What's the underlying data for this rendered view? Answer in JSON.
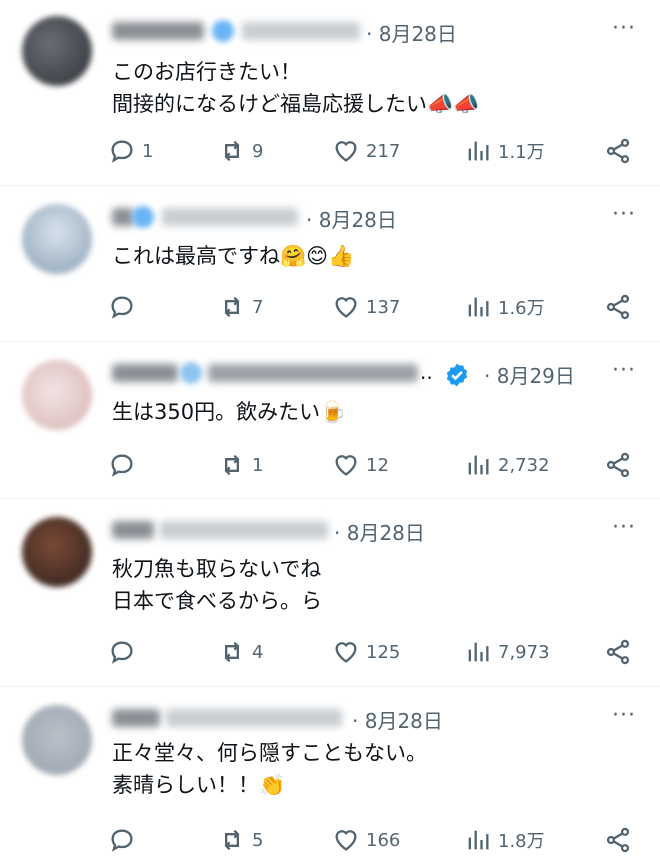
{
  "tweets": [
    {
      "date": "8月28日",
      "more": "···",
      "lines": [
        "このお店行きたい！",
        "間接的になるけど福島応援したい📣📣"
      ],
      "replies": "1",
      "retweets": "9",
      "likes": "217",
      "views": "1.1万"
    },
    {
      "date": "8月28日",
      "more": "···",
      "lines": [
        "これは最高ですね🤗😊👍"
      ],
      "replies": "",
      "retweets": "7",
      "likes": "137",
      "views": "1.6万"
    },
    {
      "date": "8月29日",
      "more": "···",
      "ellipsis": "..",
      "lines": [
        "生は350円。飲みたい🍺"
      ],
      "replies": "",
      "retweets": "1",
      "likes": "12",
      "views": "2,732"
    },
    {
      "date": "8月28日",
      "more": "···",
      "lines": [
        "秋刀魚も取らないでね",
        "日本で食べるから。ら"
      ],
      "replies": "",
      "retweets": "4",
      "likes": "125",
      "views": "7,973"
    },
    {
      "date": "8月28日",
      "more": "···",
      "lines": [
        "正々堂々、何ら隠すこともない。",
        "素晴らしい！！👏"
      ],
      "replies": "",
      "retweets": "5",
      "likes": "166",
      "views": "1.8万"
    }
  ],
  "icons": {
    "reply": "reply-icon",
    "retweet": "retweet-icon",
    "like": "heart-icon",
    "views": "views-icon",
    "share": "share-icon",
    "verified": "verified-badge-icon"
  },
  "colors": {
    "text": "#0f1419",
    "muted": "#536471",
    "verified": "#1d9bf0",
    "divider": "#eff3f4"
  }
}
